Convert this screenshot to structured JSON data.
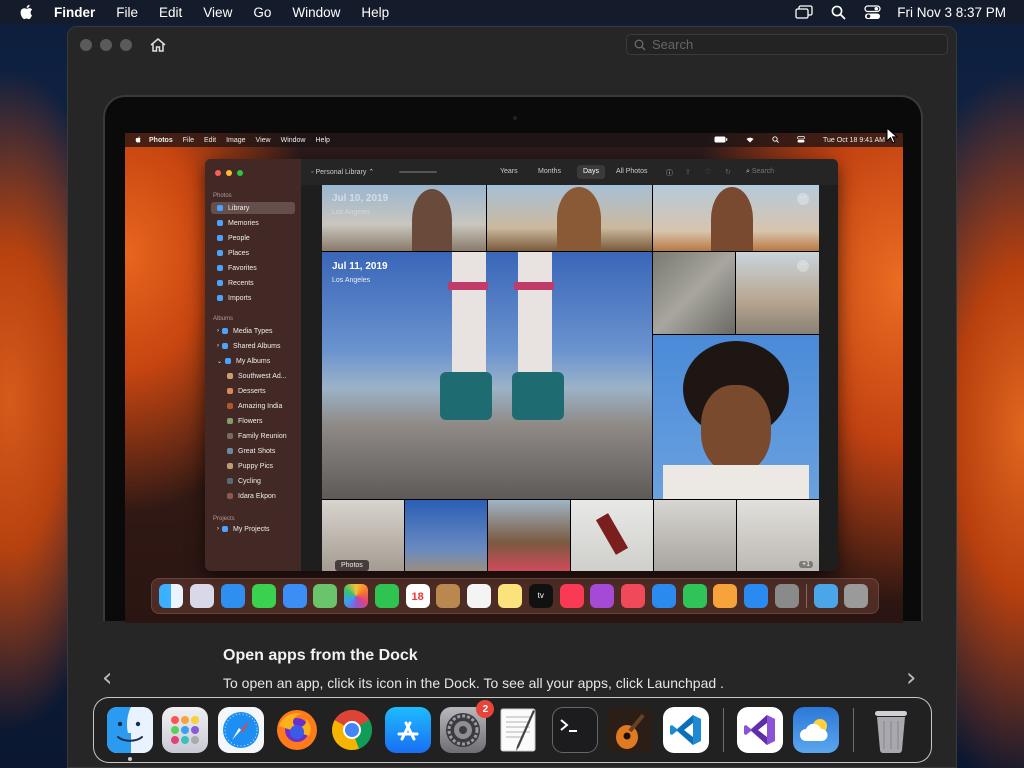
{
  "menubar": {
    "app_name": "Finder",
    "items": [
      "File",
      "Edit",
      "View",
      "Go",
      "Window",
      "Help"
    ],
    "clock": "Fri Nov 3  8:37 PM",
    "icons": [
      "screen-mirroring-icon",
      "spotlight-search-icon",
      "control-center-icon"
    ]
  },
  "window": {
    "search_placeholder": "Search"
  },
  "inner_screen": {
    "menubar": {
      "app_name": "Photos",
      "items": [
        "File",
        "Edit",
        "Image",
        "View",
        "Window",
        "Help"
      ],
      "clock": "Tue Oct 18  9:41 AM"
    },
    "photos": {
      "library_selector": "Personal Library",
      "view_tabs": [
        "Years",
        "Months",
        "Days",
        "All Photos"
      ],
      "active_tab": "Days",
      "search_placeholder": "Search",
      "sidebar": {
        "section_photos": "Photos",
        "photos_items": [
          "Library",
          "Memories",
          "People",
          "Places",
          "Favorites",
          "Recents",
          "Imports"
        ],
        "section_albums": "Albums",
        "album_groups": [
          "Media Types",
          "Shared Albums",
          "My Albums"
        ],
        "albums": [
          "Southwest Ad...",
          "Desserts",
          "Amazing India",
          "Flowers",
          "Family Reunion",
          "Great Shots",
          "Puppy Pics",
          "Cycling",
          "Idara Ekpon"
        ],
        "section_projects": "Projects",
        "projects": [
          "My Projects"
        ]
      },
      "day1": {
        "date": "Jul 10, 2019",
        "location": "Los Angeles"
      },
      "day2": {
        "date": "Jul 11, 2019",
        "location": "Los Angeles"
      },
      "more_count": "+1"
    },
    "dock_tooltip": "Photos"
  },
  "caption": {
    "title": "Open apps from the Dock",
    "text": "To open an app, click its icon in the Dock. To see all your apps, click Launchpad ."
  },
  "nav": {
    "prev": "‹",
    "next": "›"
  },
  "dock": {
    "apps": [
      {
        "name": "Finder",
        "icon": "finder-icon",
        "running": true
      },
      {
        "name": "Launchpad",
        "icon": "launchpad-icon"
      },
      {
        "name": "Safari",
        "icon": "safari-icon"
      },
      {
        "name": "Firefox",
        "icon": "firefox-icon"
      },
      {
        "name": "Google Chrome",
        "icon": "chrome-icon"
      },
      {
        "name": "App Store",
        "icon": "app-store-icon"
      },
      {
        "name": "System Settings",
        "icon": "system-settings-icon",
        "badge": "2"
      },
      {
        "name": "TextEdit",
        "icon": "textedit-icon"
      },
      {
        "name": "Terminal",
        "icon": "terminal-icon"
      },
      {
        "name": "GarageBand",
        "icon": "garageband-icon"
      },
      {
        "name": "Visual Studio Code",
        "icon": "vscode-icon"
      },
      {
        "name": "Visual Studio",
        "icon": "visual-studio-icon"
      },
      {
        "name": "Weather",
        "icon": "weather-icon"
      },
      {
        "name": "Trash",
        "icon": "trash-icon"
      }
    ]
  },
  "colors": {
    "accent": "#0a84ff",
    "badge": "#e8443a",
    "wallpaper_orange": "#d65a1b",
    "wallpaper_blue": "#132646"
  }
}
